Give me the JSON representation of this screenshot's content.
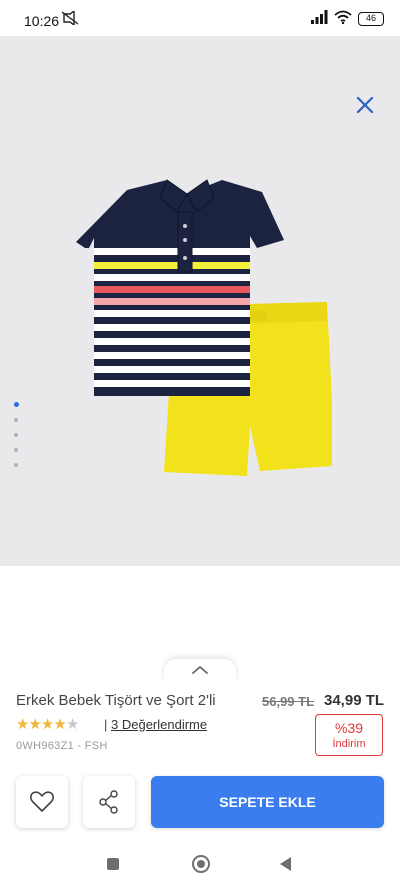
{
  "status_bar": {
    "time": "10:26",
    "battery": "46",
    "icons": [
      "mute-icon",
      "signal-icon",
      "wifi-icon",
      "battery-icon"
    ]
  },
  "gallery": {
    "image_count": 5,
    "active_index": 0,
    "close_icon": "close-icon"
  },
  "product": {
    "title": "Erkek Bebek Tişört ve Şort 2'li",
    "old_price": "56,99 TL",
    "new_price": "34,99 TL",
    "rating": 4,
    "rating_max": 5,
    "review_separator": "|",
    "review_link": "3 Değerlendirme",
    "sku": "0WH963Z1 - FSH",
    "discount_pct": "%39",
    "discount_label": "İndirim"
  },
  "actions": {
    "favorite_icon": "heart-icon",
    "share_icon": "share-icon",
    "cart_label": "SEPETE EKLE"
  },
  "colors": {
    "accent": "#3b7cee",
    "discount": "#e03a3a",
    "star": "#f0b83a"
  }
}
